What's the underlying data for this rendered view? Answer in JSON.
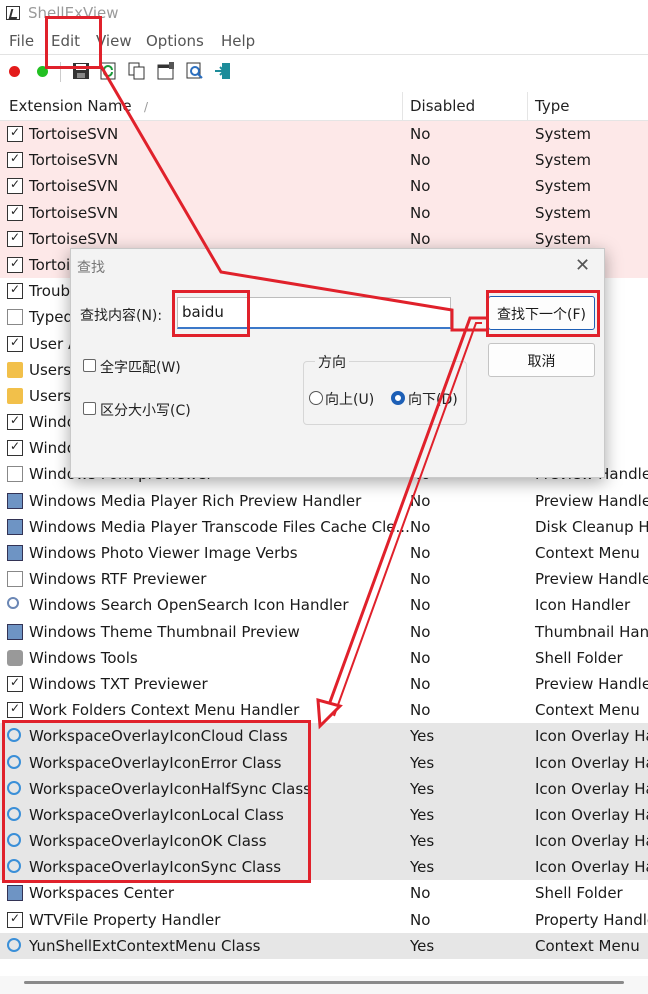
{
  "window": {
    "title": "ShellExView"
  },
  "menu": [
    "File",
    "Edit",
    "View",
    "Options",
    "Help"
  ],
  "toolbar": {
    "icons": [
      "red-dot-icon",
      "green-dot-icon",
      "save-icon",
      "refresh-icon",
      "copy-icon",
      "properties-icon",
      "find-icon",
      "exit-icon"
    ]
  },
  "columns": {
    "name": "Extension Name",
    "sort_indicator": "/",
    "disabled": "Disabled",
    "type": "Type"
  },
  "rows": [
    {
      "name": "TortoiseSVN",
      "disabled": "No",
      "type": "System",
      "icon": "doc-check",
      "bg": "pink"
    },
    {
      "name": "TortoiseSVN",
      "disabled": "No",
      "type": "System",
      "icon": "doc-check",
      "bg": "pink"
    },
    {
      "name": "TortoiseSVN",
      "disabled": "No",
      "type": "System",
      "icon": "doc-check",
      "bg": "pink"
    },
    {
      "name": "TortoiseSVN",
      "disabled": "No",
      "type": "System",
      "icon": "doc-check",
      "bg": "pink"
    },
    {
      "name": "TortoiseSVN",
      "disabled": "No",
      "type": "System",
      "icon": "doc-check",
      "bg": "pink"
    },
    {
      "name": "Tortoi",
      "disabled": "",
      "type": "",
      "icon": "doc-check",
      "bg": "pink"
    },
    {
      "name": "Troub",
      "disabled": "",
      "type": "ler",
      "icon": "doc-check",
      "bg": ""
    },
    {
      "name": "Typed",
      "disabled": "",
      "type": "il Hand",
      "icon": "blank",
      "bg": ""
    },
    {
      "name": "User A",
      "disabled": "",
      "type": "ler",
      "icon": "doc-check",
      "bg": ""
    },
    {
      "name": "Users",
      "disabled": "",
      "type": "ler",
      "icon": "folder",
      "bg": ""
    },
    {
      "name": "Users",
      "disabled": "",
      "type": "ler",
      "icon": "folder",
      "bg": ""
    },
    {
      "name": "Windo",
      "disabled": "",
      "type": "ler",
      "icon": "doc-check",
      "bg": ""
    },
    {
      "name": "Windo",
      "disabled": "",
      "type": "ler",
      "icon": "doc-check",
      "bg": ""
    },
    {
      "name": "Windows Font previewer",
      "disabled": "No",
      "type": "Preview Handler",
      "icon": "blank",
      "bg": ""
    },
    {
      "name": "Windows Media Player Rich Preview Handler",
      "disabled": "No",
      "type": "Preview Handler",
      "icon": "pic",
      "bg": ""
    },
    {
      "name": "Windows Media Player Transcode Files Cache Cle...",
      "disabled": "No",
      "type": "Disk Cleanup Ha",
      "icon": "pic",
      "bg": ""
    },
    {
      "name": "Windows Photo Viewer Image Verbs",
      "disabled": "No",
      "type": "Context Menu",
      "icon": "pic",
      "bg": ""
    },
    {
      "name": "Windows RTF Previewer",
      "disabled": "No",
      "type": "Preview Handler",
      "icon": "blank",
      "bg": ""
    },
    {
      "name": "Windows Search OpenSearch Icon Handler",
      "disabled": "No",
      "type": "Icon Handler",
      "icon": "mag",
      "bg": ""
    },
    {
      "name": "Windows Theme Thumbnail Preview",
      "disabled": "No",
      "type": "Thumbnail Hand",
      "icon": "pic",
      "bg": ""
    },
    {
      "name": "Windows Tools",
      "disabled": "No",
      "type": "Shell Folder",
      "icon": "gear",
      "bg": ""
    },
    {
      "name": "Windows TXT Previewer",
      "disabled": "No",
      "type": "Preview Handler",
      "icon": "doc-check",
      "bg": ""
    },
    {
      "name": "Work Folders Context Menu Handler",
      "disabled": "No",
      "type": "Context Menu",
      "icon": "doc-check",
      "bg": ""
    },
    {
      "name": "WorkspaceOverlayIconCloud Class",
      "disabled": "Yes",
      "type": "Icon Overlay Ha",
      "icon": "cloud",
      "bg": "gray"
    },
    {
      "name": "WorkspaceOverlayIconError Class",
      "disabled": "Yes",
      "type": "Icon Overlay Ha",
      "icon": "cloud",
      "bg": "gray"
    },
    {
      "name": "WorkspaceOverlayIconHalfSync Class",
      "disabled": "Yes",
      "type": "Icon Overlay Ha",
      "icon": "cloud",
      "bg": "gray"
    },
    {
      "name": "WorkspaceOverlayIconLocal Class",
      "disabled": "Yes",
      "type": "Icon Overlay Ha",
      "icon": "cloud",
      "bg": "gray"
    },
    {
      "name": "WorkspaceOverlayIconOK Class",
      "disabled": "Yes",
      "type": "Icon Overlay Ha",
      "icon": "cloud",
      "bg": "gray"
    },
    {
      "name": "WorkspaceOverlayIconSync Class",
      "disabled": "Yes",
      "type": "Icon Overlay Ha",
      "icon": "cloud",
      "bg": "gray"
    },
    {
      "name": "Workspaces Center",
      "disabled": "No",
      "type": "Shell Folder",
      "icon": "pic",
      "bg": ""
    },
    {
      "name": "WTVFile Property Handler",
      "disabled": "No",
      "type": "Property Handle",
      "icon": "doc-check",
      "bg": ""
    },
    {
      "name": "YunShellExtContextMenu Class",
      "disabled": "Yes",
      "type": "Context Menu",
      "icon": "cloud",
      "bg": "gray"
    }
  ],
  "dialog": {
    "title": "查找",
    "find_label": "查找内容(N):",
    "find_value": "baidu",
    "find_next": "查找下一个(F)",
    "cancel": "取消",
    "whole_word": "全字匹配(W)",
    "match_case": "区分大小写(C)",
    "direction": "方向",
    "up": "向上(U)",
    "down": "向下(D)",
    "direction_selected": "down"
  },
  "annotation_color": "#e0212b"
}
